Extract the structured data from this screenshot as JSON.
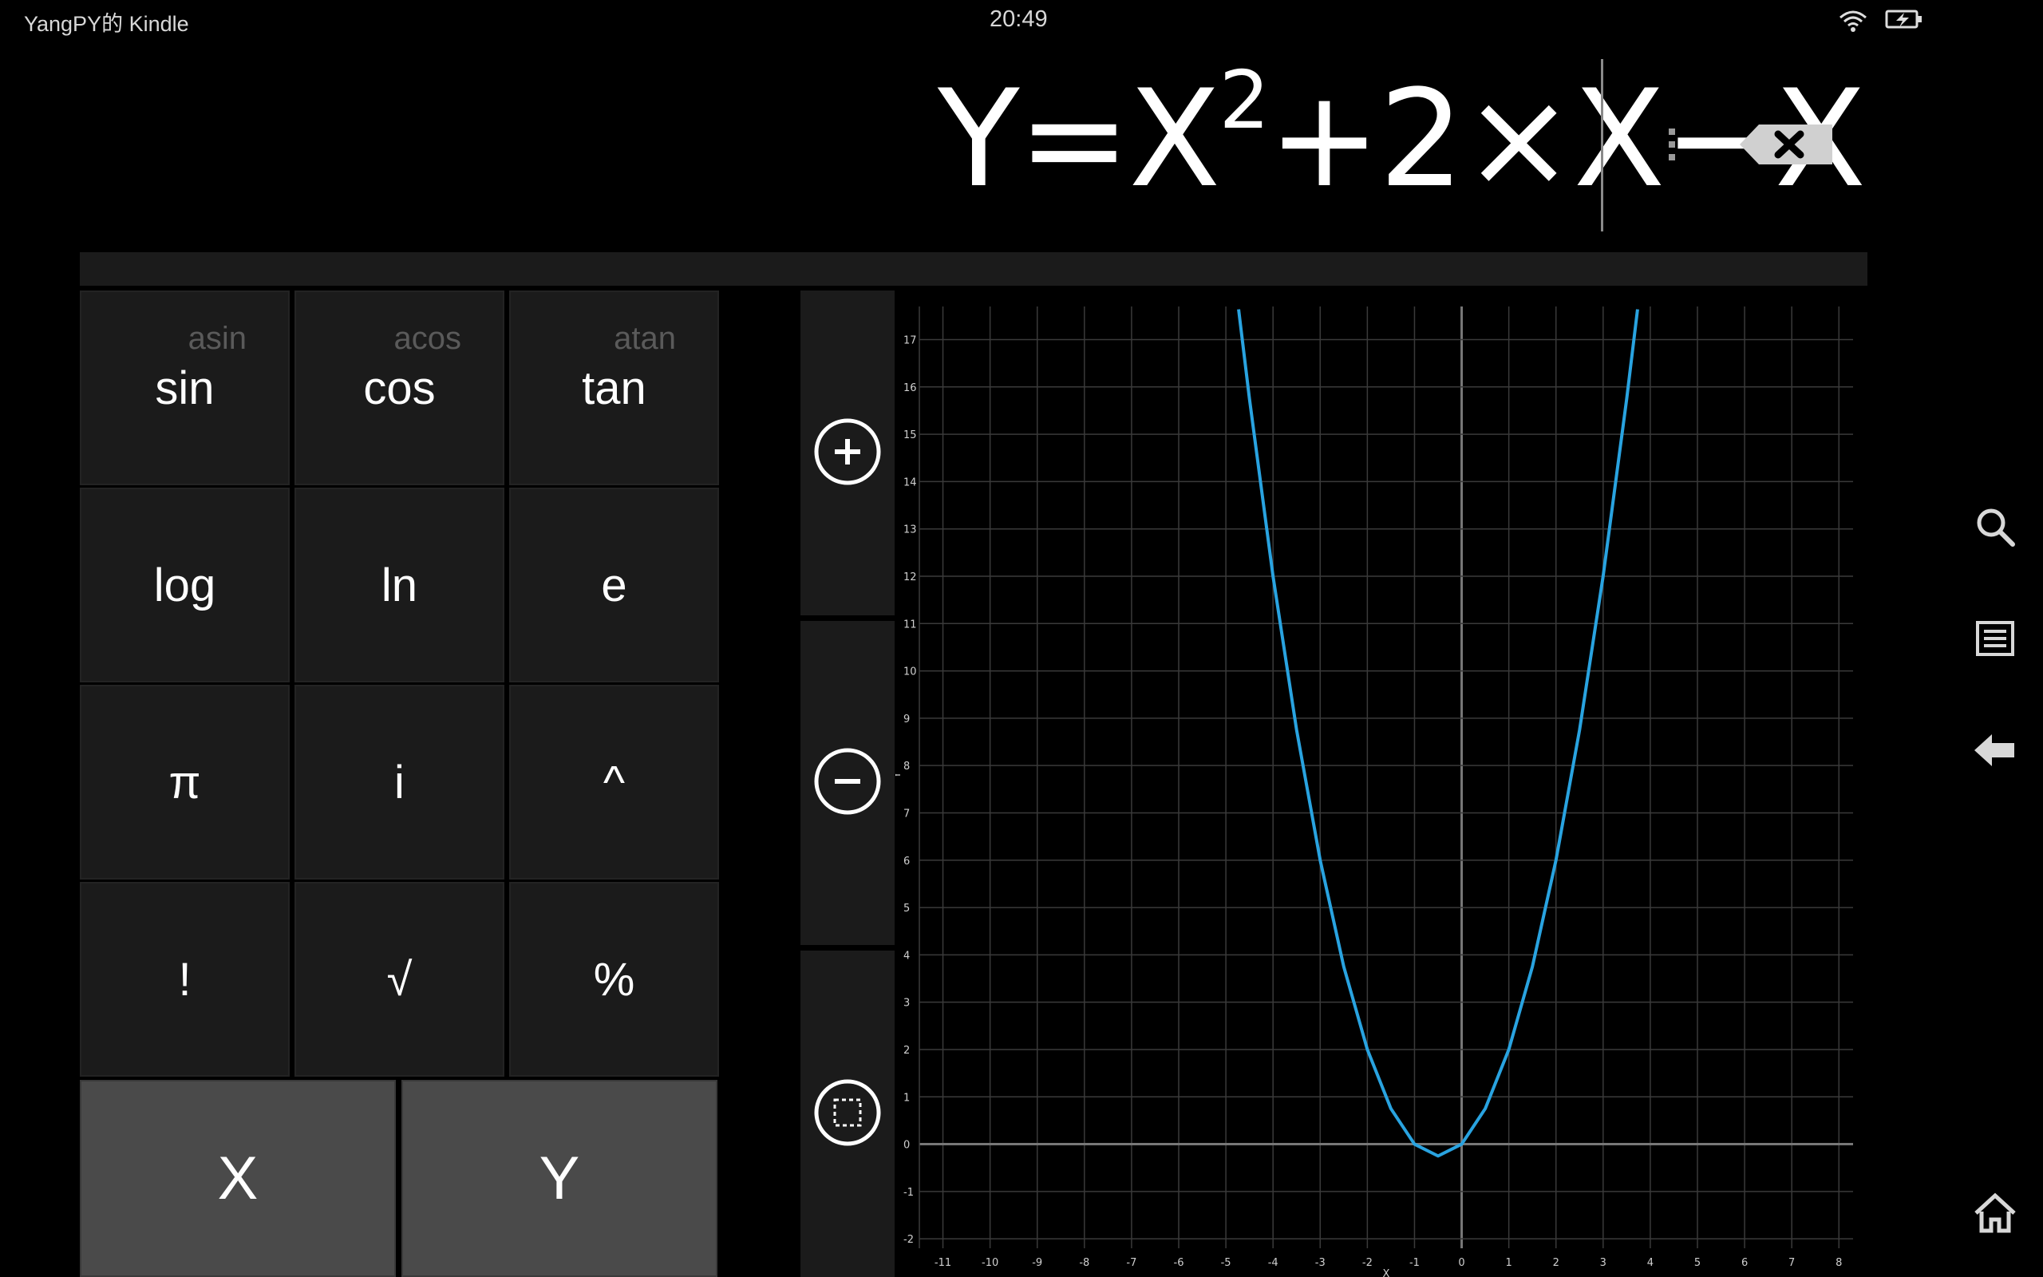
{
  "status": {
    "device_name": "YangPY的 Kindle",
    "time": "20:49",
    "icons": [
      "wifi-icon",
      "battery-charging-icon"
    ]
  },
  "formula": {
    "prefix": "Y=X",
    "exponent": "2",
    "suffix": "+2×X−X",
    "buttons": [
      "menu-dots-icon",
      "backspace-icon"
    ]
  },
  "keypad": {
    "rows": [
      [
        {
          "label": "sin",
          "alt": "asin"
        },
        {
          "label": "cos",
          "alt": "acos"
        },
        {
          "label": "tan",
          "alt": "atan"
        }
      ],
      [
        {
          "label": "log"
        },
        {
          "label": "ln"
        },
        {
          "label": "e"
        }
      ],
      [
        {
          "label": "π"
        },
        {
          "label": "i"
        },
        {
          "label": "^"
        }
      ],
      [
        {
          "label": "!"
        },
        {
          "label": "√"
        },
        {
          "label": "%"
        }
      ]
    ],
    "variables": [
      "X",
      "Y"
    ]
  },
  "zoom_controls": [
    "zoom-in-icon",
    "zoom-out-icon",
    "zoom-fit-icon"
  ],
  "nav": [
    "search-icon",
    "menu-list-icon",
    "back-arrow-icon",
    "home-icon"
  ],
  "chart_data": {
    "type": "line",
    "function": "Y=X^2+2×X−X",
    "xlabel": "X",
    "ylabel": "Y",
    "xlim": [
      -11.5,
      8.3
    ],
    "ylim": [
      -2.2,
      17.7
    ],
    "x_ticks": [
      "-11",
      "-10",
      "-9",
      "-8",
      "-7",
      "-6",
      "-5",
      "-4",
      "-3",
      "-2",
      "-1",
      "0",
      "1",
      "2",
      "3",
      "4",
      "5",
      "6",
      "7",
      "8"
    ],
    "y_ticks": [
      "-2",
      "-1",
      "0",
      "1",
      "2",
      "3",
      "4",
      "5",
      "6",
      "7",
      "8",
      "9",
      "10",
      "11",
      "12",
      "13",
      "14",
      "15",
      "16",
      "17"
    ],
    "grid": true,
    "series": [
      {
        "color": "#29a3e0",
        "x": [
          -4.73,
          -4.5,
          -4,
          -3.5,
          -3,
          -2.5,
          -2,
          -1.5,
          -1,
          -0.5,
          0,
          0.5,
          1,
          1.5,
          2,
          2.5,
          3,
          3.5,
          3.73
        ],
        "y": [
          17.64,
          15.75,
          12,
          8.75,
          6,
          3.75,
          2,
          0.75,
          0,
          -0.25,
          0,
          0.75,
          2,
          3.75,
          6,
          8.75,
          12,
          15.75,
          17.64
        ]
      }
    ]
  }
}
